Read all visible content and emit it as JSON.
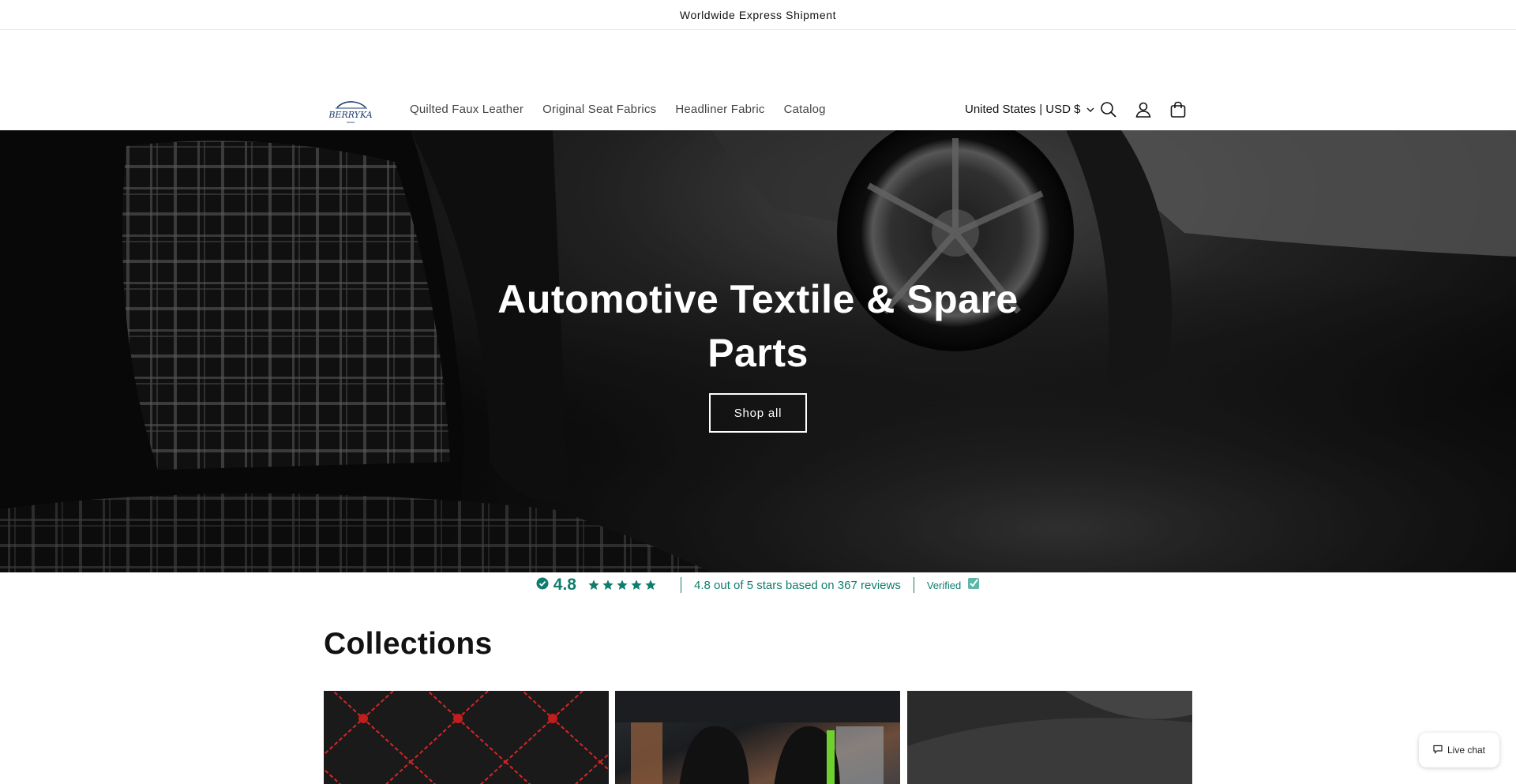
{
  "announcement": {
    "text": "Worldwide Express Shipment"
  },
  "header": {
    "logo_text": "BERRYKA",
    "nav": [
      {
        "label": "Quilted Faux Leather"
      },
      {
        "label": "Original Seat Fabrics"
      },
      {
        "label": "Headliner Fabric"
      },
      {
        "label": "Catalog"
      }
    ],
    "locale": "United States | USD $",
    "icons": [
      "search-icon",
      "account-icon",
      "cart-icon"
    ]
  },
  "hero": {
    "title_line1": "Automotive Textile & Spare",
    "title_line2": "Parts",
    "button_label": "Shop all"
  },
  "reviews": {
    "score": "4.8",
    "stars": 5,
    "summary": "4.8 out of 5 stars based on 367 reviews",
    "verified_label": "Verified",
    "accent": "#0f7d6e"
  },
  "collections": {
    "title": "Collections"
  },
  "livechat": {
    "label": "Live chat"
  }
}
